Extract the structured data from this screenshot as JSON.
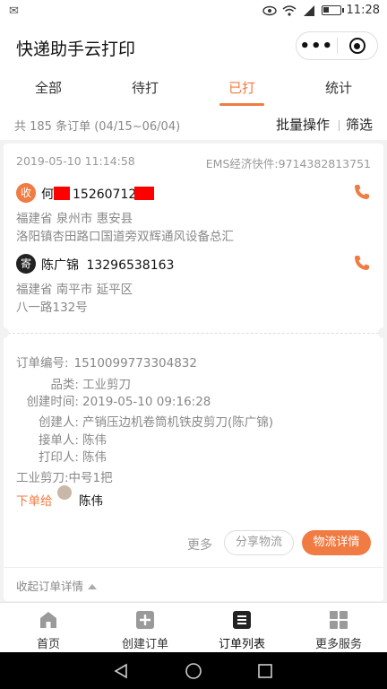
{
  "status_bar": {
    "time": "11:28"
  },
  "app": {
    "title": "快递助手云打印",
    "more_icon": "more-dots-icon",
    "close_icon": "target-close-icon"
  },
  "tabs": [
    {
      "label": "全部",
      "active": false
    },
    {
      "label": "待打",
      "active": false
    },
    {
      "label": "已打",
      "active": true
    },
    {
      "label": "统计",
      "active": false
    }
  ],
  "summary": {
    "text": "共 185 条订单 (04/15~06/04)",
    "batch_label": "批量操作",
    "filter_label": "筛选"
  },
  "order": {
    "datetime": "2019-05-10 11:14:58",
    "express": "EMS经济快件:9714382813751",
    "receiver": {
      "badge": "收",
      "name_visible": "何",
      "phone_visible": "15260712",
      "address_line1": "福建省 泉州市 惠安县",
      "address_line2": "洛阳镇杏田路口国道旁双辉通风设备总汇"
    },
    "sender": {
      "badge": "寄",
      "name": "陈广锦",
      "phone": "13296538163",
      "address_line1": "福建省 南平市 延平区",
      "address_line2": "八一路132号"
    },
    "fields": [
      {
        "label": "订单编号:",
        "value": "1510099773304832"
      },
      {
        "label": "品类:",
        "value": "工业剪刀"
      },
      {
        "label": "创建时间:",
        "value": "2019-05-10 09:16:28"
      },
      {
        "label": "创建人:",
        "value": "产销压边机卷筒机铁皮剪刀(陈广锦)"
      },
      {
        "label": "接单人:",
        "value": "陈伟"
      },
      {
        "label": "打印人:",
        "value": "陈伟"
      }
    ],
    "goods_line": "工业剪刀:中号1把",
    "assign_label": "下单给",
    "assign_to": "陈伟",
    "more_label": "更多",
    "share_label": "分享物流",
    "detail_label": "物流详情",
    "collapse_label": "收起订单详情"
  },
  "tabbar": [
    {
      "label": "首页",
      "icon": "home-icon"
    },
    {
      "label": "创建订单",
      "icon": "plus-square-icon"
    },
    {
      "label": "订单列表",
      "icon": "list-icon",
      "active": true
    },
    {
      "label": "更多服务",
      "icon": "grid-icon"
    }
  ],
  "colors": {
    "accent": "#f07b43",
    "text": "#333333",
    "muted": "#888888"
  }
}
